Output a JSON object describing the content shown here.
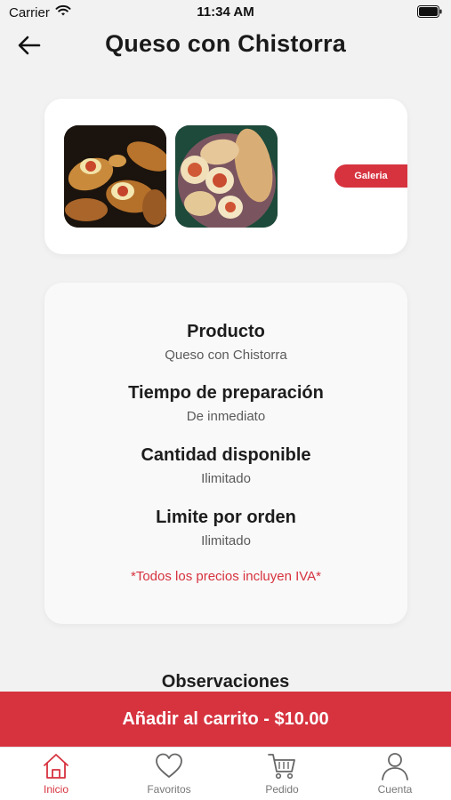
{
  "status_bar": {
    "carrier": "Carrier",
    "time": "11:34 AM"
  },
  "header": {
    "title": "Queso con Chistorra"
  },
  "gallery": {
    "tag_label": "Galeria"
  },
  "info": {
    "product_label": "Producto",
    "product_value": "Queso con Chistorra",
    "prep_label": "Tiempo de preparación",
    "prep_value": "De inmediato",
    "qty_label": "Cantidad disponible",
    "qty_value": "Ilimitado",
    "limit_label": "Limite por orden",
    "limit_value": "Ilimitado",
    "iva_note": "*Todos los precios incluyen IVA*"
  },
  "observations": {
    "title": "Observaciones"
  },
  "cart": {
    "label": "Añadir al carrito - $10.00"
  },
  "tabs": [
    {
      "label": "Inicio",
      "icon": "home-icon",
      "active": true
    },
    {
      "label": "Favoritos",
      "icon": "heart-icon",
      "active": false
    },
    {
      "label": "Pedido",
      "icon": "cart-icon",
      "active": false
    },
    {
      "label": "Cuenta",
      "icon": "user-icon",
      "active": false
    }
  ],
  "colors": {
    "accent": "#d6333f",
    "background": "#f2f2f2",
    "card": "#ffffff"
  }
}
